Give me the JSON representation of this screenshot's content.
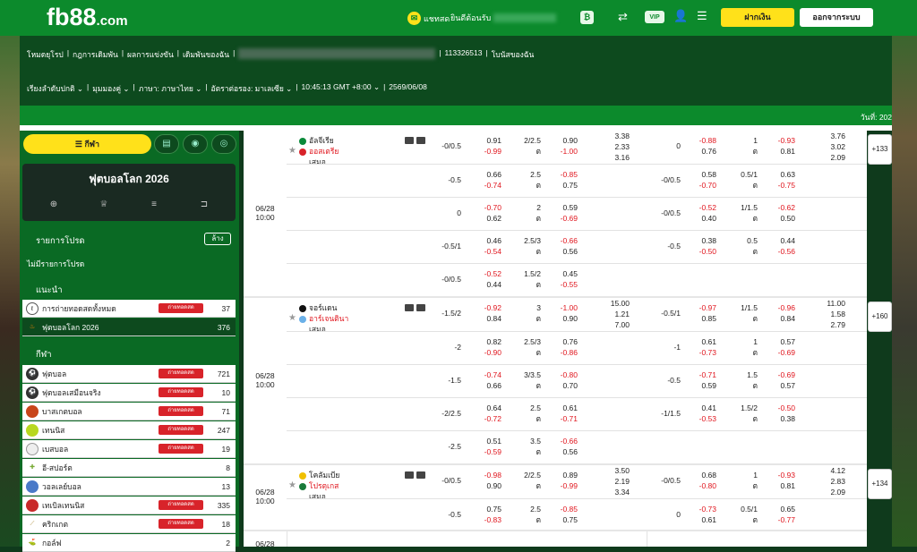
{
  "topbar": {
    "logo_main": "fb88",
    "logo_suffix": ".com",
    "chat": "แชทสด",
    "welcome": "ยินดีต้อนรับ",
    "deposit": "ฝากเงิน",
    "logout": "ออกจากระบบ"
  },
  "info": {
    "links": [
      "โหมดยุโรป",
      "กฎการเดิมพัน",
      "ผลการแข่งขัน",
      "เดิมพันของฉัน"
    ],
    "account_id": "113326513",
    "my_bonus": "โบนัสของฉัน",
    "sort": "เรียงลำดับปกติ",
    "view": "มุมมองคู่",
    "lang": "ภาษา: ภาษาไทย",
    "odds": "อัตราต่อรอง: มาเลเซีย",
    "time": "10:45:13 GMT +8:00",
    "date": "2569/06/08"
  },
  "datebar": "วันที่: 202",
  "sidebar": {
    "sport_pill": "กีฬา",
    "worldcup": "ฟุตบอลโลก 2026",
    "favorites": "รายการโปรด",
    "clear": "ล้าง",
    "nofav": "ไม่มีรายการโปรด",
    "recommend": "แนะนำ",
    "badge": "ถ่ายทอดสด",
    "rec_items": [
      {
        "name": "การถ่ายทอดสดทั้งหมด",
        "count": "37"
      },
      {
        "name": "ฟุตบอลโลก 2026",
        "count": "376"
      }
    ],
    "sports_title": "กีฬา",
    "sports": [
      {
        "name": "ฟุตบอล",
        "count": "721",
        "badge": true
      },
      {
        "name": "ฟุตบอลเสมือนจริง",
        "count": "10",
        "badge": true
      },
      {
        "name": "บาสเกตบอล",
        "count": "71",
        "badge": true
      },
      {
        "name": "เทนนิส",
        "count": "247",
        "badge": true
      },
      {
        "name": "เบสบอล",
        "count": "19",
        "badge": true
      },
      {
        "name": "อี-สปอร์ต",
        "count": "8",
        "badge": false
      },
      {
        "name": "วอลเลย์บอล",
        "count": "13",
        "badge": false
      },
      {
        "name": "เทเบิลเทนนิส",
        "count": "335",
        "badge": true
      },
      {
        "name": "คริกเกต",
        "count": "18",
        "badge": true
      },
      {
        "name": "กอล์ฟ",
        "count": "2",
        "badge": false
      }
    ]
  },
  "matches": [
    {
      "date": "06/28",
      "time": "10:00",
      "home": "อัลจีเรีย",
      "away": "ออสเตรีย",
      "draw": "เสมอ",
      "more": "+133",
      "rows": [
        {
          "h1": "-0/0.5",
          "a1": "0.91",
          "b1": "-0.99",
          "h2": "2/2.5",
          "u": "ต",
          "o1": "0.90",
          "o2": "-1.00",
          "x1": "3.38",
          "x2": "2.33",
          "x3": "3.16",
          "h3": "0",
          "a3": "-0.88",
          "b3": "0.76",
          "h4": "1",
          "u4": "ต",
          "o3": "-0.93",
          "o4": "0.81",
          "y1": "3.76",
          "y2": "3.02",
          "y3": "2.09"
        },
        {
          "h1": "-0.5",
          "a1": "0.66",
          "b1": "-0.74",
          "h2": "2.5",
          "u": "ต",
          "o1": "-0.85",
          "o2": "0.75",
          "h3": "-0/0.5",
          "a3": "0.58",
          "b3": "-0.70",
          "h4": "0.5/1",
          "u4": "ต",
          "o3": "0.63",
          "o4": "-0.75"
        },
        {
          "h1": "0",
          "a1": "-0.70",
          "b1": "0.62",
          "h2": "2",
          "u": "ต",
          "o1": "0.59",
          "o2": "-0.69",
          "h3": "-0/0.5",
          "a3": "-0.52",
          "b3": "0.40",
          "h4": "1/1.5",
          "u4": "ต",
          "o3": "-0.62",
          "o4": "0.50"
        },
        {
          "h1": "-0.5/1",
          "a1": "0.46",
          "b1": "-0.54",
          "h2": "2.5/3",
          "u": "ต",
          "o1": "-0.66",
          "o2": "0.56",
          "h3": "-0.5",
          "a3": "0.38",
          "b3": "-0.50",
          "h4": "0.5",
          "u4": "ต",
          "o3": "0.44",
          "o4": "-0.56"
        },
        {
          "h1": "-0/0.5",
          "a1": "-0.52",
          "b1": "0.44",
          "h2": "1.5/2",
          "u": "ต",
          "o1": "0.45",
          "o2": "-0.55"
        }
      ]
    },
    {
      "date": "06/28",
      "time": "10:00",
      "home": "จอร์แดน",
      "away": "อาร์เจนตินา",
      "draw": "เสมอ",
      "more": "+160",
      "rows": [
        {
          "h1": "-1.5/2",
          "a1": "-0.92",
          "b1": "0.84",
          "h2": "3",
          "u": "ต",
          "o1": "-1.00",
          "o2": "0.90",
          "x1": "15.00",
          "x2": "1.21",
          "x3": "7.00",
          "h3": "-0.5/1",
          "a3": "-0.97",
          "b3": "0.85",
          "h4": "1/1.5",
          "u4": "ต",
          "o3": "-0.96",
          "o4": "0.84",
          "y1": "11.00",
          "y2": "1.58",
          "y3": "2.79"
        },
        {
          "h1": "-2",
          "a1": "0.82",
          "b1": "-0.90",
          "h2": "2.5/3",
          "u": "ต",
          "o1": "0.76",
          "o2": "-0.86",
          "h3": "-1",
          "a3": "0.61",
          "b3": "-0.73",
          "h4": "1",
          "u4": "ต",
          "o3": "0.57",
          "o4": "-0.69"
        },
        {
          "h1": "-1.5",
          "a1": "-0.74",
          "b1": "0.66",
          "h2": "3/3.5",
          "u": "ต",
          "o1": "-0.80",
          "o2": "0.70",
          "h3": "-0.5",
          "a3": "-0.71",
          "b3": "0.59",
          "h4": "1.5",
          "u4": "ต",
          "o3": "-0.69",
          "o4": "0.57"
        },
        {
          "h1": "-2/2.5",
          "a1": "0.64",
          "b1": "-0.72",
          "h2": "2.5",
          "u": "ต",
          "o1": "0.61",
          "o2": "-0.71",
          "h3": "-1/1.5",
          "a3": "0.41",
          "b3": "-0.53",
          "h4": "1.5/2",
          "u4": "ต",
          "o3": "-0.50",
          "o4": "0.38"
        },
        {
          "h1": "-2.5",
          "a1": "0.51",
          "b1": "-0.59",
          "h2": "3.5",
          "u": "ต",
          "o1": "-0.66",
          "o2": "0.56"
        }
      ]
    },
    {
      "date": "06/28",
      "time": "10:00",
      "home": "โคลัมเบีย",
      "away": "โปรตุเกส",
      "draw": "เสมอ",
      "more": "+134",
      "rows": [
        {
          "h1": "-0/0.5",
          "a1": "-0.98",
          "b1": "0.90",
          "h2": "2/2.5",
          "u": "ต",
          "o1": "0.89",
          "o2": "-0.99",
          "x1": "3.50",
          "x2": "2.19",
          "x3": "3.34",
          "h3": "-0/0.5",
          "a3": "0.68",
          "b3": "-0.80",
          "h4": "1",
          "u4": "ต",
          "o3": "-0.93",
          "o4": "0.81",
          "y1": "4.12",
          "y2": "2.83",
          "y3": "2.09"
        },
        {
          "h1": "-0.5",
          "a1": "0.75",
          "b1": "-0.83",
          "h2": "2.5",
          "u": "ต",
          "o1": "-0.85",
          "o2": "0.75",
          "h3": "0",
          "a3": "-0.73",
          "b3": "0.61",
          "h4": "0.5/1",
          "u4": "ต",
          "o3": "0.65",
          "o4": "-0.77"
        }
      ]
    }
  ],
  "next_match_date": "06/28"
}
